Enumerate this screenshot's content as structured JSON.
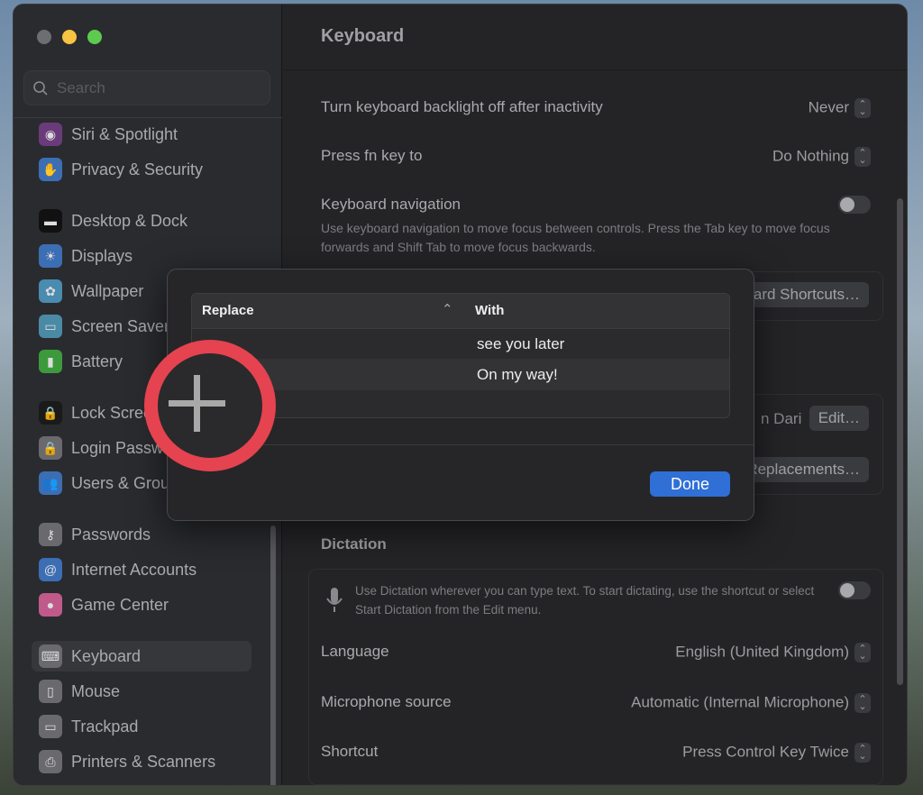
{
  "window": {
    "title": "Keyboard",
    "traffic_lights": {
      "close": "#6b6e73",
      "minimize": "#f6c342",
      "zoom": "#5ccb4f"
    }
  },
  "sidebar": {
    "search_placeholder": "Search",
    "items": [
      {
        "label": "Siri & Spotlight",
        "icon": "siri-icon",
        "color": "#6a3b7a"
      },
      {
        "label": "Privacy & Security",
        "icon": "hand-icon",
        "color": "#3c6eb4"
      },
      {
        "label": "Desktop & Dock",
        "icon": "dock-icon",
        "color": "#111111"
      },
      {
        "label": "Displays",
        "icon": "sun-icon",
        "color": "#3c6eb4"
      },
      {
        "label": "Wallpaper",
        "icon": "flower-icon",
        "color": "#4a8bb0"
      },
      {
        "label": "Screen Saver",
        "icon": "screen-saver-icon",
        "color": "#4b8aa5"
      },
      {
        "label": "Battery",
        "icon": "battery-icon",
        "color": "#3c9a3c"
      },
      {
        "label": "Lock Screen",
        "icon": "lock-icon",
        "color": "#1a1a1a"
      },
      {
        "label": "Login Password",
        "icon": "padlock-icon",
        "color": "#6a6a6e"
      },
      {
        "label": "Users & Groups",
        "icon": "users-icon",
        "color": "#3c6eb4"
      },
      {
        "label": "Passwords",
        "icon": "key-icon",
        "color": "#6a6a6e"
      },
      {
        "label": "Internet Accounts",
        "icon": "at-icon",
        "color": "#3c6eb4"
      },
      {
        "label": "Game Center",
        "icon": "game-center-icon",
        "color": "#c05a8a"
      },
      {
        "label": "Keyboard",
        "icon": "keyboard-icon",
        "color": "#6a6a6e",
        "selected": true
      },
      {
        "label": "Mouse",
        "icon": "mouse-icon",
        "color": "#6a6a6e"
      },
      {
        "label": "Trackpad",
        "icon": "trackpad-icon",
        "color": "#6a6a6e"
      },
      {
        "label": "Printers & Scanners",
        "icon": "printer-icon",
        "color": "#6a6a6e"
      }
    ]
  },
  "main": {
    "backlight": {
      "label": "Turn keyboard backlight off after inactivity",
      "value": "Never"
    },
    "fn_key": {
      "label": "Press fn key to",
      "value": "Do Nothing"
    },
    "navigation": {
      "label": "Keyboard navigation",
      "description": "Use keyboard navigation to move focus between controls. Press the Tab key to move focus forwards and Shift Tab to move focus backwards.",
      "enabled": false
    },
    "shortcuts_button": "Keyboard Shortcuts…",
    "input_source": "n Dari",
    "edit_button": "Edit…",
    "text_replacements_button": "Text Replacements…",
    "dictation": {
      "section": "Dictation",
      "description": "Use Dictation wherever you can type text. To start dictating, use the shortcut or select Start Dictation from the Edit menu.",
      "enabled": false,
      "language": {
        "label": "Language",
        "value": "English (United Kingdom)"
      },
      "microphone": {
        "label": "Microphone source",
        "value": "Automatic (Internal Microphone)"
      },
      "shortcut": {
        "label": "Shortcut",
        "value": "Press Control Key Twice"
      }
    }
  },
  "sheet": {
    "columns": {
      "replace": "Replace",
      "with": "With"
    },
    "rows": [
      {
        "replace": "",
        "with": "see you later"
      },
      {
        "replace": "",
        "with": "On my way!"
      }
    ],
    "done_label": "Done",
    "annotation_color": "#e5434f"
  }
}
